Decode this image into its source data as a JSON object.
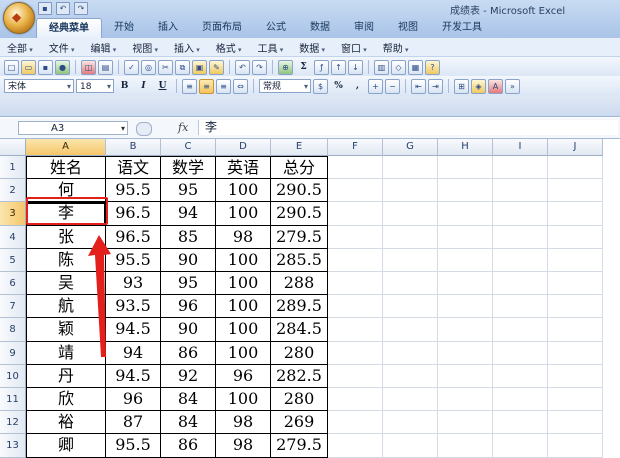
{
  "window": {
    "title": "成绩表 - Microsoft Excel"
  },
  "ribbon_tabs": [
    "经典菜单",
    "开始",
    "插入",
    "页面布局",
    "公式",
    "数据",
    "审阅",
    "视图",
    "开发工具"
  ],
  "menus": [
    "全部",
    "文件",
    "编辑",
    "视图",
    "插入",
    "格式",
    "工具",
    "数据",
    "窗口",
    "帮助"
  ],
  "toolbar": {
    "font_name": "宋体",
    "font_size": "18",
    "bold": "B",
    "italic": "I",
    "underline": "U",
    "number_format": "常规",
    "sum_symbol": "Σ",
    "percent": "%",
    "comma": ","
  },
  "formula_bar": {
    "name_box": "A3",
    "fx": "fx",
    "value": "李"
  },
  "sheet": {
    "columns": [
      "A",
      "B",
      "C",
      "D",
      "E",
      "F",
      "G",
      "H",
      "I",
      "J"
    ],
    "rows": [
      "1",
      "2",
      "3",
      "4",
      "5",
      "6",
      "7",
      "8",
      "9",
      "10",
      "11",
      "12",
      "13"
    ],
    "header": [
      "姓名",
      "语文",
      "数学",
      "英语",
      "总分"
    ],
    "data": [
      [
        "何",
        "95.5",
        "95",
        "100",
        "290.5"
      ],
      [
        "李",
        "96.5",
        "94",
        "100",
        "290.5"
      ],
      [
        "张",
        "96.5",
        "85",
        "98",
        "279.5"
      ],
      [
        "陈",
        "95.5",
        "90",
        "100",
        "285.5"
      ],
      [
        "吴",
        "93",
        "95",
        "100",
        "288"
      ],
      [
        "航",
        "93.5",
        "96",
        "100",
        "289.5"
      ],
      [
        "颖",
        "94.5",
        "90",
        "100",
        "284.5"
      ],
      [
        "靖",
        "94",
        "86",
        "100",
        "280"
      ],
      [
        "丹",
        "94.5",
        "92",
        "96",
        "282.5"
      ],
      [
        "欣",
        "96",
        "84",
        "100",
        "280"
      ],
      [
        "裕",
        "87",
        "84",
        "98",
        "269"
      ],
      [
        "卿",
        "95.5",
        "86",
        "98",
        "279.5"
      ]
    ],
    "active_cell": "A3"
  },
  "annotation": {
    "highlight_color": "#e3201b"
  }
}
